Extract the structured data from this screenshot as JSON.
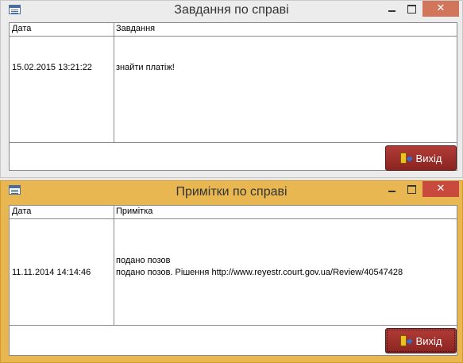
{
  "tasks_window": {
    "title": "Завдання по справі",
    "columns": {
      "date": "Дата",
      "task": "Завдання"
    },
    "rows": [
      {
        "date": "15.02.2015 13:21:22",
        "task": "знайти платіж!"
      }
    ],
    "controls": {
      "minimize": "",
      "maximize": "",
      "close": "✕"
    },
    "exit_label": "Вихід"
  },
  "notes_window": {
    "title": "Примітки по справі",
    "columns": {
      "date": "Дата",
      "note": "Примітка"
    },
    "rows": [
      {
        "date": "11.11.2014 14:14:46",
        "note_line1": "подано позов",
        "note_line2": "подано позов. Рішення http://www.reyestr.court.gov.ua/Review/40547428"
      }
    ],
    "controls": {
      "minimize": "",
      "maximize": "",
      "close": "✕"
    },
    "exit_label": "Вихід"
  },
  "colors": {
    "active_titlebar": "#e8b751",
    "inactive_titlebar": "#ececec",
    "close_button": "#c84a3c",
    "exit_button": "#9b2e2a"
  }
}
